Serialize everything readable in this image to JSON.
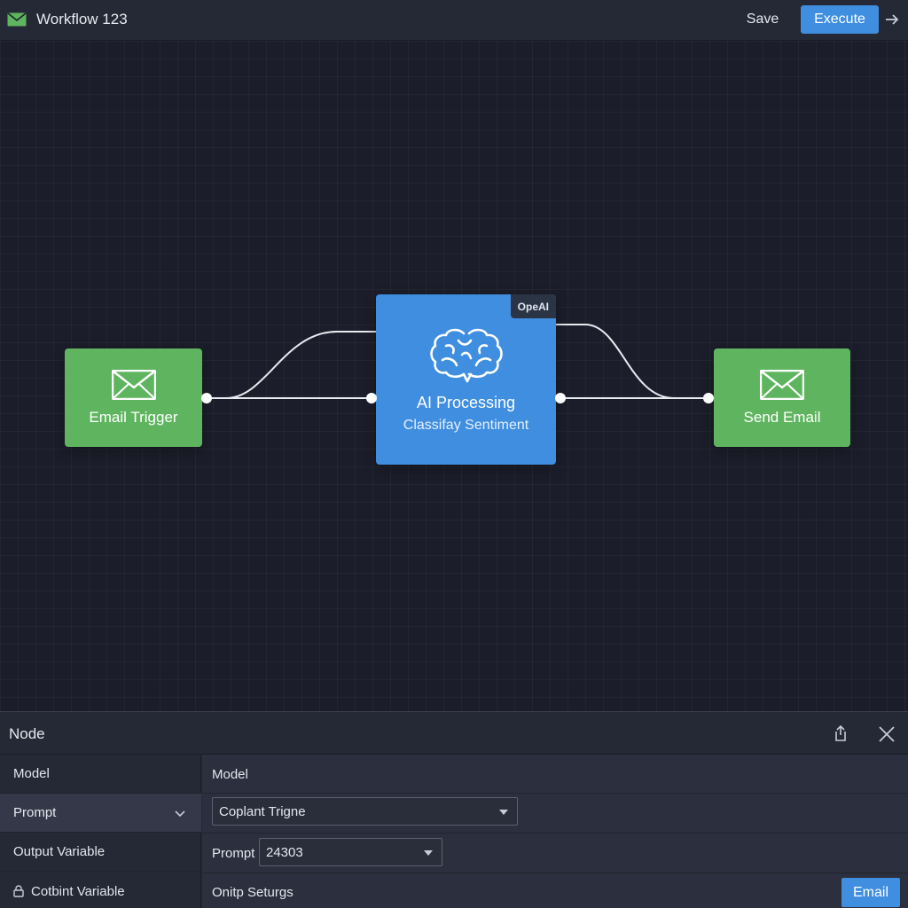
{
  "header": {
    "title": "Workflow 123",
    "save_label": "Save",
    "execute_label": "Execute",
    "app_icon": "envelope-icon",
    "arrow_icon": "arrow-right-icon"
  },
  "canvas": {
    "nodes": {
      "email_trigger": {
        "label": "Email Trigger",
        "icon": "envelope-icon",
        "color": "#5fb55f"
      },
      "ai_processing": {
        "label": "AI Processing",
        "sublabel": "Classifay Sentiment",
        "badge": "OpeAI",
        "icon": "brain-icon",
        "color": "#3f8ee0"
      },
      "send_email": {
        "label": "Send Email",
        "icon": "envelope-icon",
        "color": "#5fb55f"
      }
    }
  },
  "panel": {
    "title": "Node",
    "sidebar": {
      "items": [
        {
          "label": "Model"
        },
        {
          "label": "Prompt"
        },
        {
          "label": "Output Variable"
        },
        {
          "label": "Cotbint Variable"
        }
      ]
    },
    "detail": {
      "model_label": "Model",
      "model_value": "Coplant Trigne",
      "prompt_label": "Prompt",
      "prompt_value": "24303",
      "settings_label": "Onitp Seturgs",
      "email_button": "Email"
    }
  },
  "colors": {
    "accent": "#3f8ee0",
    "node_green": "#5fb55f",
    "background": "#1c1f2b"
  }
}
